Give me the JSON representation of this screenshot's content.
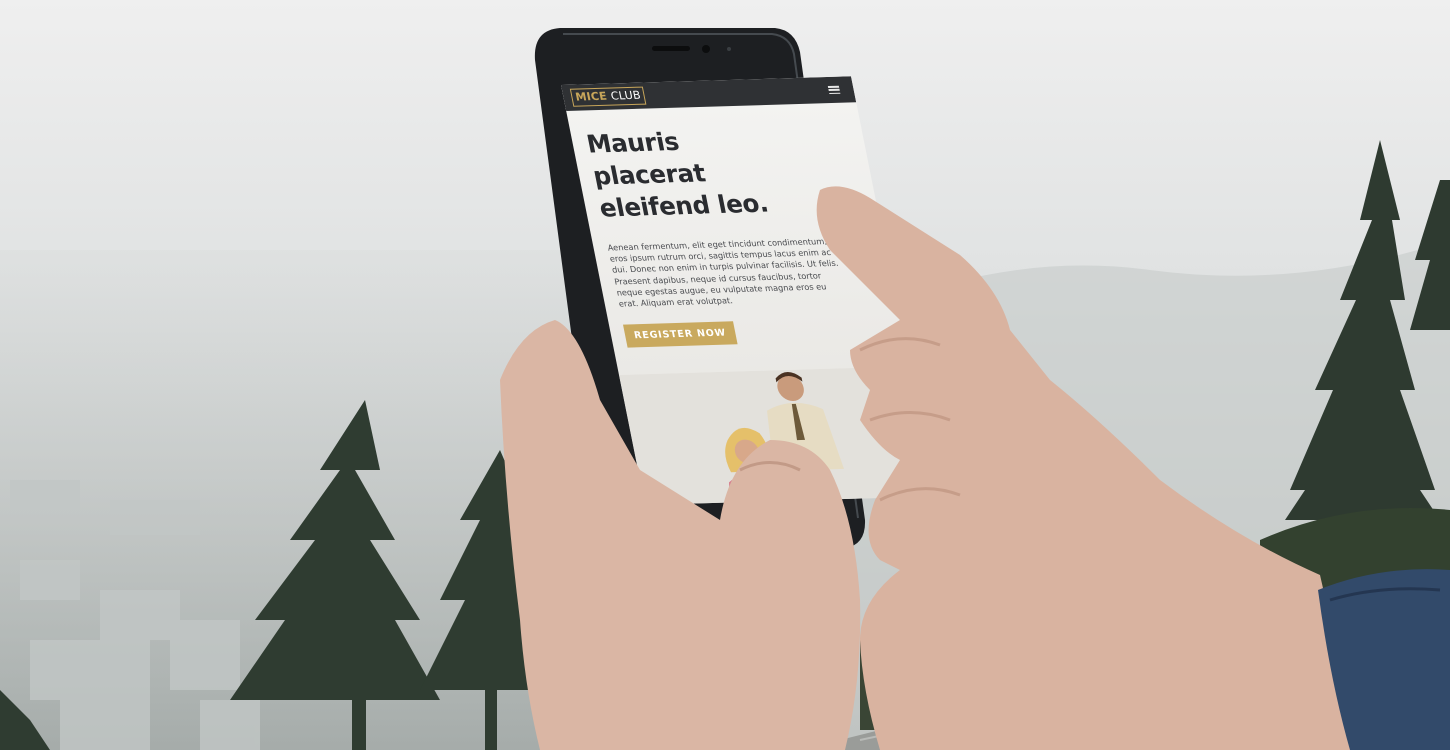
{
  "website": {
    "logo": {
      "part1": "MICE",
      "part2": "CLUB"
    },
    "hero": {
      "headline_lines": [
        "Mauris",
        "placerat",
        "eleifend leo."
      ],
      "body": "Aenean fermentum, elit eget tincidunt condimentum, eros ipsum rutrum orci, sagittis tempus lacus enim ac dui. Donec non enim in turpis pulvinar facilisis. Ut felis. Praesent dapibus, neque id cursus faucibus, tortor neque egestas augue, eu vulputate magna eros eu erat. Aliquam erat volutpat.",
      "cta_label": "REGISTER NOW"
    }
  },
  "colors": {
    "brand_gold": "#c9a95e",
    "navbar": "#2f3134",
    "headline": "#2a2c30"
  },
  "icons": {
    "menu": "hamburger-menu-icon"
  }
}
